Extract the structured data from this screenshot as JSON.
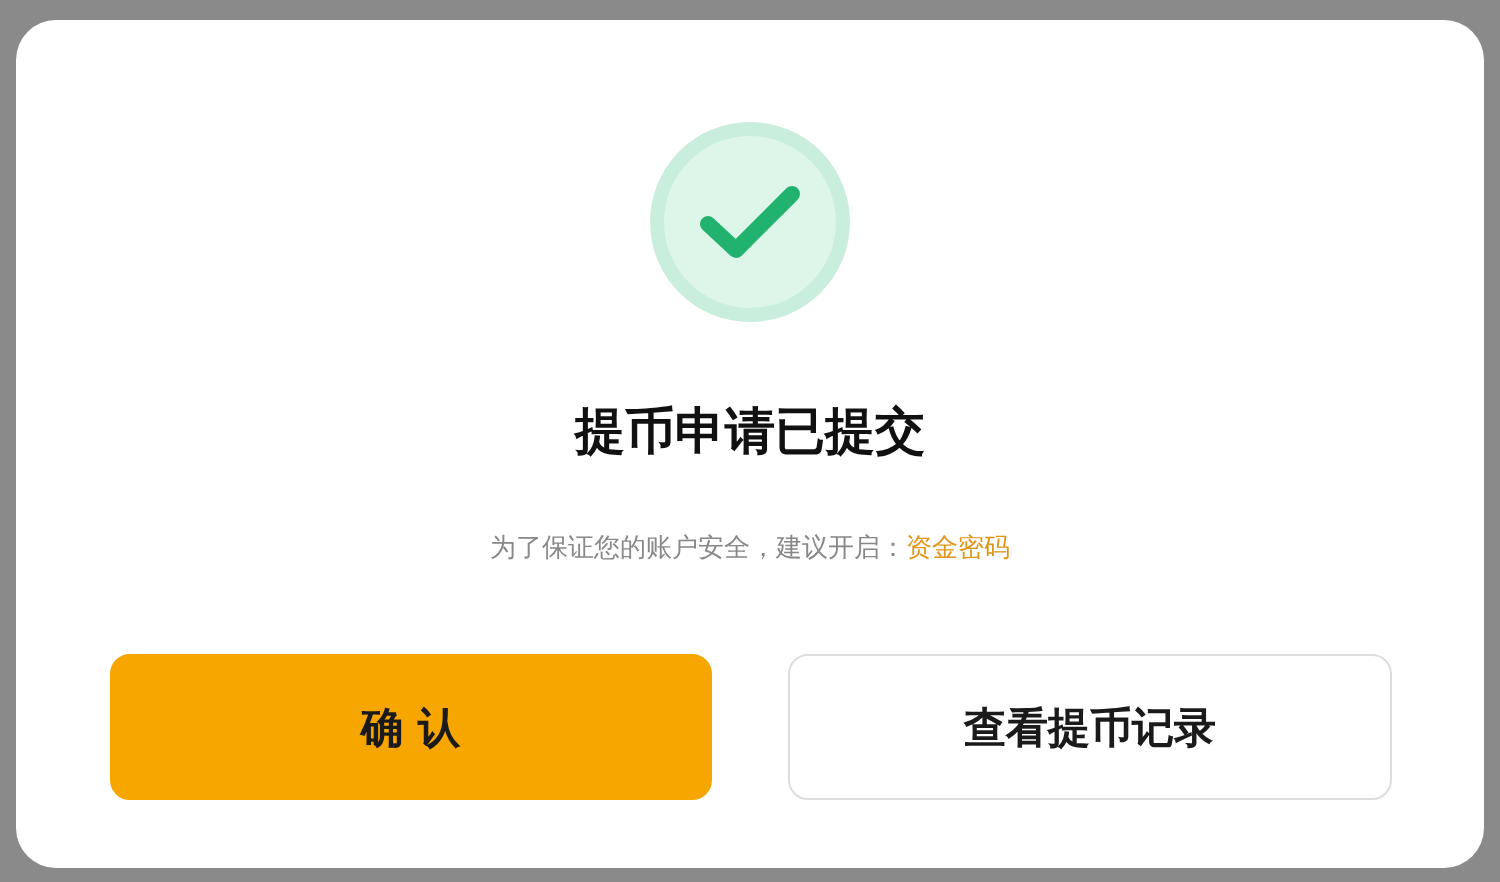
{
  "dialog": {
    "title": "提币申请已提交",
    "message": {
      "text": "为了保证您的账户安全，建议开启：",
      "link": "资金密码"
    },
    "buttons": [
      {
        "label": "确 认",
        "kind": "primary"
      },
      {
        "label": "查看提币记录",
        "kind": "secondary"
      }
    ]
  }
}
